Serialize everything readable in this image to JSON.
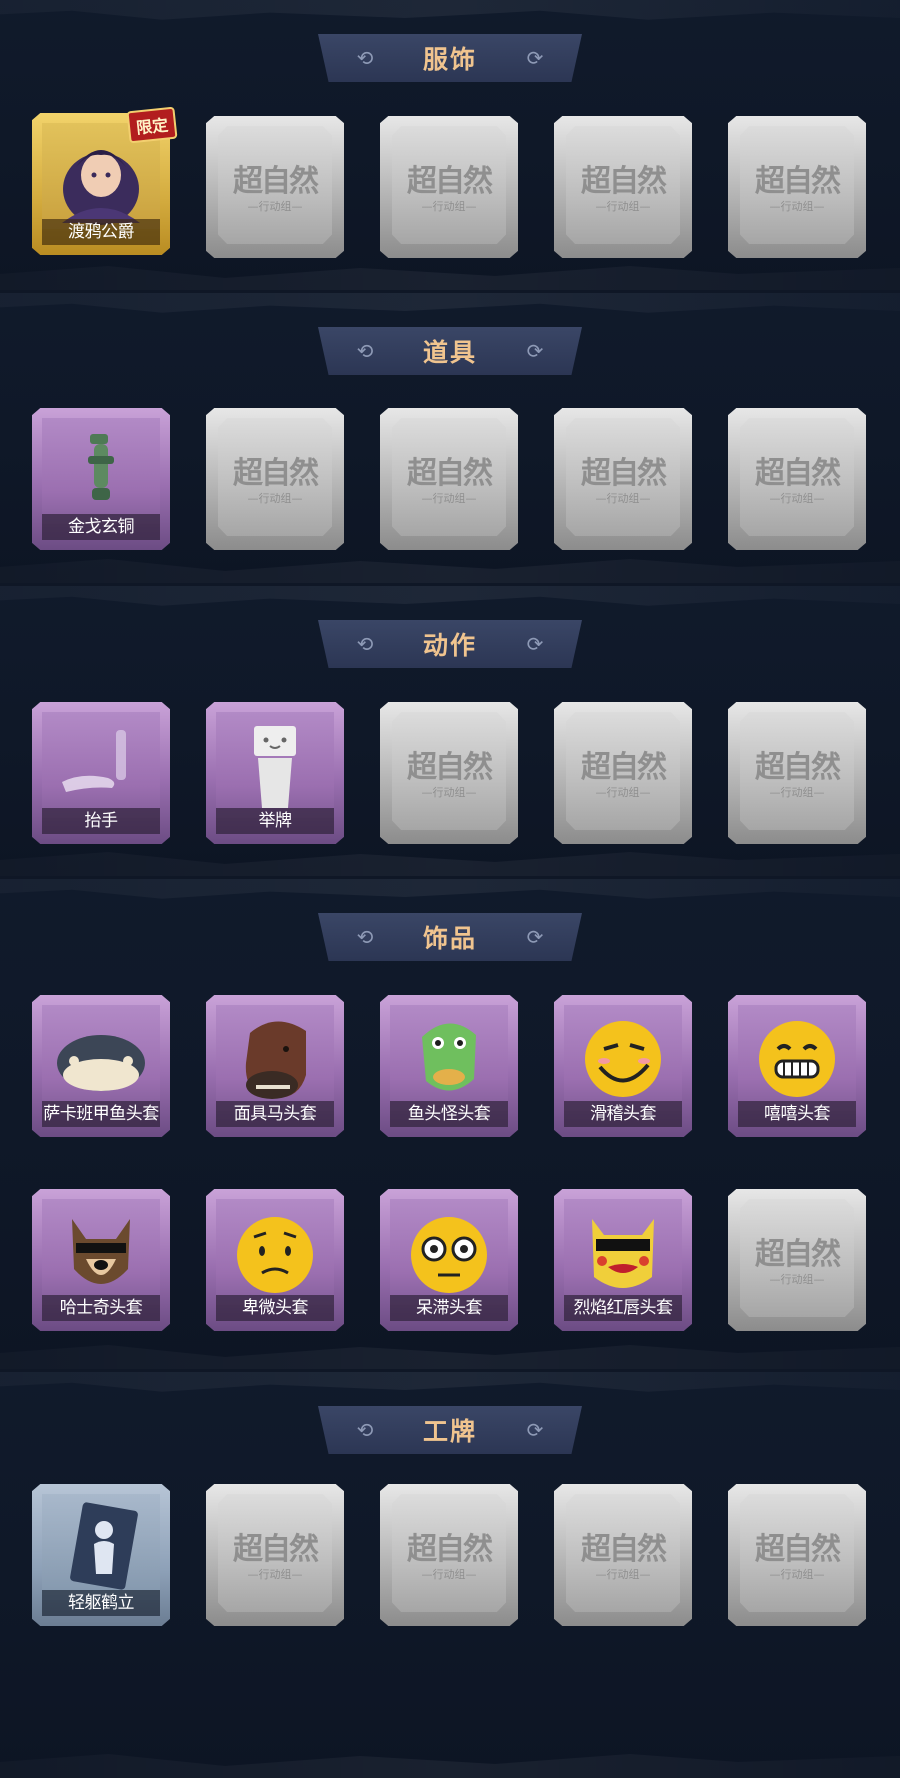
{
  "sections": [
    {
      "title": "服饰"
    },
    {
      "title": "道具"
    },
    {
      "title": "动作"
    },
    {
      "title": "饰品"
    },
    {
      "title": "工牌"
    }
  ],
  "watermark": {
    "main": "超自然",
    "sub": "—行动组—"
  },
  "items": {
    "duya": {
      "label": "渡鸦公爵",
      "badge": "限定"
    },
    "jinge": {
      "label": "金戈玄铜"
    },
    "taishou": {
      "label": "抬手"
    },
    "jupai": {
      "label": "举牌"
    },
    "sakabanjia": {
      "label": "萨卡班甲鱼头套"
    },
    "mianjuma": {
      "label": "面具马头套"
    },
    "yutouguai": {
      "label": "鱼头怪头套"
    },
    "huaji": {
      "label": "滑稽头套"
    },
    "xixi": {
      "label": "嘻嘻头套"
    },
    "hashiqi": {
      "label": "哈士奇头套"
    },
    "beiwei": {
      "label": "卑微头套"
    },
    "daizhi": {
      "label": "呆滞头套"
    },
    "lieyan": {
      "label": "烈焰红唇头套"
    },
    "qingqu": {
      "label": "轻躯鹤立"
    }
  },
  "colors": {
    "title_text": "#f0c48f",
    "background": "#0f1726",
    "limited_badge": "#b21e1e"
  }
}
